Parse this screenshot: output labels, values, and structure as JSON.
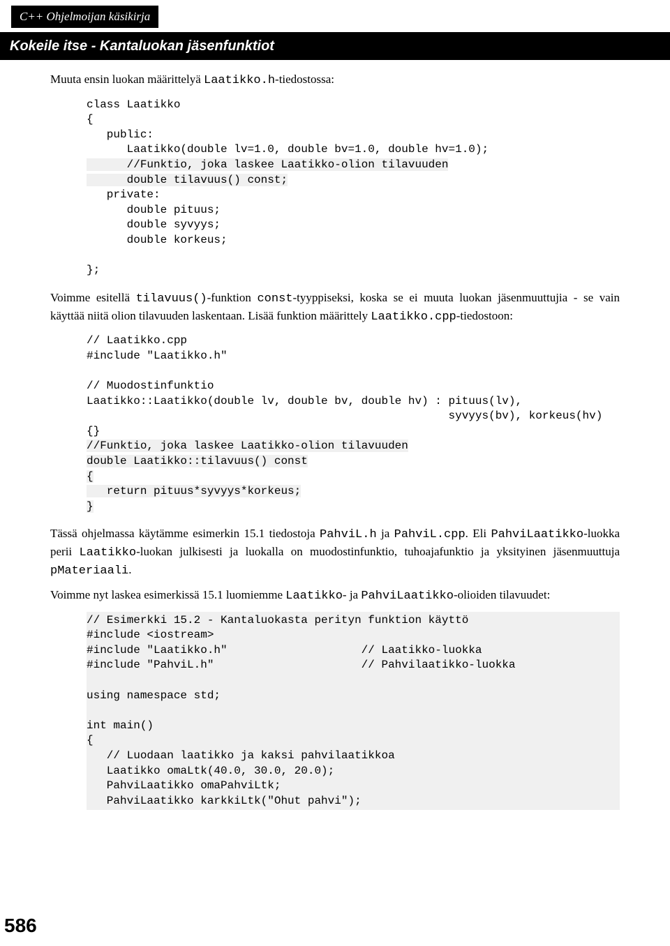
{
  "book_title": "C++ Ohjelmoijan käsikirja",
  "section_title": "Kokeile itse - Kantaluokan jäsenfunktiot",
  "p1_pre": "Muuta ensin luokan määrittelyä ",
  "p1_code": "Laatikko.h",
  "p1_post": "-tiedostossa:",
  "code1_a": "class Laatikko\n{\n   public:\n      Laatikko(double lv=1.0, double bv=1.0, double hv=1.0);",
  "code1_b": "\n      //Funktio, joka laskee Laatikko-olion tilavuuden\n      double tilavuus() const;",
  "code1_c": "\n   private:\n      double pituus;\n      double syvyys;\n      double korkeus;\n\n};",
  "p2_a": "Voimme esitellä ",
  "p2_code1": "tilavuus()",
  "p2_b": "-funktion ",
  "p2_code2": "const",
  "p2_c": "-tyyppiseksi, koska se ei muuta luokan jäsenmuuttujia - se vain käyttää niitä olion tilavuuden laskentaan. Lisää funktion määrittely ",
  "p2_code3": "Laatikko.cpp",
  "p2_d": "-tiedostoon:",
  "code2_a": "// Laatikko.cpp\n#include \"Laatikko.h\"\n\n// Muodostinfunktio\nLaatikko::Laatikko(double lv, double bv, double hv) : pituus(lv),\n                                                      syvyys(bv), korkeus(hv)\n{}",
  "code2_b": "\n//Funktio, joka laskee Laatikko-olion tilavuuden\ndouble Laatikko::tilavuus() const\n{\n   return pituus*syvyys*korkeus;\n}",
  "p3_a": "Tässä ohjelmassa käytämme esimerkin 15.1 tiedostoja ",
  "p3_code1": "PahviL.h",
  "p3_b": " ja ",
  "p3_code2": "PahviL.cpp",
  "p3_c": ". Eli ",
  "p3_code3": "PahviLaatikko",
  "p3_d": "-luokka perii ",
  "p3_code4": "Laatikko",
  "p3_e": "-luokan julkisesti ja luokalla on muodostinfunktio, tuhoajafunktio ja yksityinen jäsenmuuttuja ",
  "p3_code5": "pMateriaali",
  "p3_f": ".",
  "p4_a": "Voimme nyt laskea esimerkissä 15.1 luomiemme ",
  "p4_code1": "Laatikko",
  "p4_b": "- ja ",
  "p4_code2": "PahviLaatikko",
  "p4_c": "-olioiden tilavuudet:",
  "code3": "// Esimerkki 15.2 - Kantaluokasta perityn funktion käyttö\n#include <iostream>\n#include \"Laatikko.h\"                    // Laatikko-luokka\n#include \"PahviL.h\"                      // Pahvilaatikko-luokka\n\nusing namespace std;\n\nint main()\n{\n   // Luodaan laatikko ja kaksi pahvilaatikkoa\n   Laatikko omaLtk(40.0, 30.0, 20.0);\n   PahviLaatikko omaPahviLtk;\n   PahviLaatikko karkkiLtk(\"Ohut pahvi\");",
  "page_number": "586"
}
